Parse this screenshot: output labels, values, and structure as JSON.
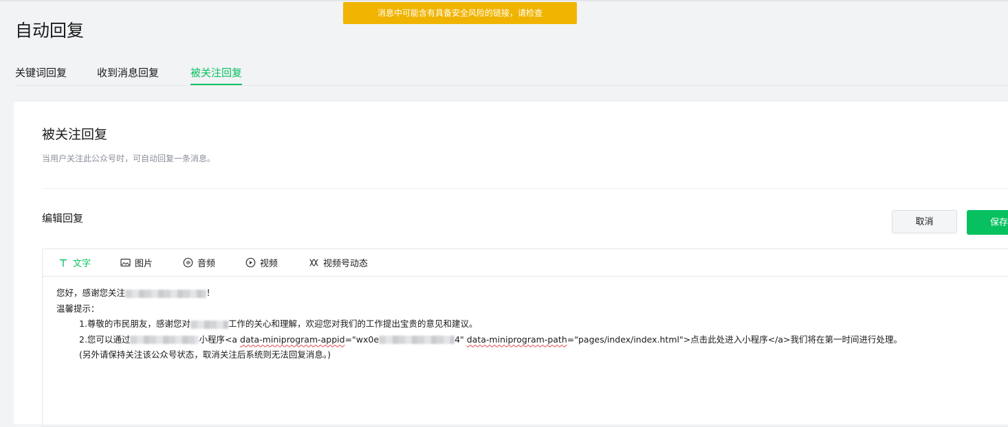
{
  "banner": {
    "warning": "消息中可能含有具备安全风险的链接，请检查"
  },
  "page": {
    "title": "自动回复"
  },
  "tabs": [
    {
      "label": "关键词回复",
      "active": false
    },
    {
      "label": "收到消息回复",
      "active": false
    },
    {
      "label": "被关注回复",
      "active": true
    }
  ],
  "section": {
    "title": "被关注回复",
    "description": "当用户关注此公众号时，可自动回复一条消息。",
    "edit_label": "编辑回复"
  },
  "actions": {
    "cancel_label": "取消",
    "save_label": "保存"
  },
  "toolbar": {
    "items": [
      {
        "label": "文字",
        "icon": "text-icon",
        "active": true
      },
      {
        "label": "图片",
        "icon": "image-icon",
        "active": false
      },
      {
        "label": "音频",
        "icon": "audio-icon",
        "active": false
      },
      {
        "label": "视频",
        "icon": "video-icon",
        "active": false
      },
      {
        "label": "视频号动态",
        "icon": "channels-icon",
        "active": false
      }
    ]
  },
  "message": {
    "greeting": "您好，感谢您关注",
    "greeting_tail": "！",
    "tip_heading": "温馨提示：",
    "item1_a": "1.尊敬的市民朋友，感谢您对",
    "item1_b": "工作的关心和理解，欢迎您对我们的工作提出宝贵的意见和建议。",
    "item2_a": "2.您可以通过",
    "item2_b": "小程序<a ",
    "item2_attr1": "data-miniprogram-appid",
    "item2_c": "=\"wx0e",
    "item2_d": "4\" ",
    "item2_attr2": "data-miniprogram-path",
    "item2_e": "=\"pages/index/index.html\">点击此处进入小程序</a>我们将在第一时间进行处理。",
    "note": "(另外请保持关注该公众号状态，取消关注后系统则无法回复消息。)"
  },
  "colors": {
    "accent": "#07c160",
    "warning": "#f0b400"
  }
}
